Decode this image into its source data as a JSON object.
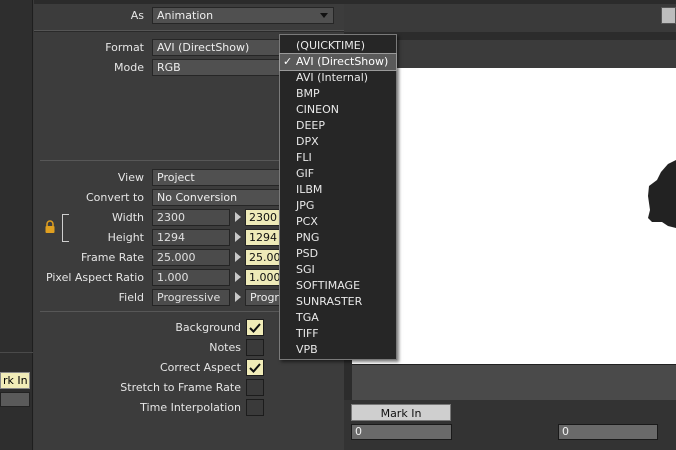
{
  "header": {
    "as_label": "As",
    "as_value": "Animation"
  },
  "settings": {
    "format_label": "Format",
    "format_value": "AVI (DirectShow)",
    "mode_label": "Mode",
    "mode_value": "RGB",
    "view_label": "View",
    "view_value": "Project",
    "convert_label": "Convert to",
    "convert_value": "No Conversion",
    "width_label": "Width",
    "width_src": "2300",
    "width_dst": "2300",
    "height_label": "Height",
    "height_src": "1294",
    "height_dst": "1294",
    "framerate_label": "Frame Rate",
    "framerate_src": "25.000",
    "framerate_dst": "25.00",
    "par_label": "Pixel Aspect Ratio",
    "par_src": "1.000",
    "par_dst": "1.000",
    "field_label": "Field",
    "field_src": "Progressive",
    "field_dst": "Progr"
  },
  "options": {
    "background_label": "Background",
    "background_checked": true,
    "notes_label": "Notes",
    "notes_checked": false,
    "correct_aspect_label": "Correct Aspect",
    "correct_aspect_checked": true,
    "stretch_label": "Stretch to Frame Rate",
    "stretch_checked": false,
    "time_interp_label": "Time Interpolation",
    "time_interp_checked": false
  },
  "format_menu": {
    "items": [
      "(QUICKTIME)",
      "AVI (DirectShow)",
      "AVI (Internal)",
      "BMP",
      "CINEON",
      "DEEP",
      "DPX",
      "FLI",
      "GIF",
      "ILBM",
      "JPG",
      "PCX",
      "PNG",
      "PSD",
      "SGI",
      "SOFTIMAGE",
      "SUNRASTER",
      "TGA",
      "TIFF",
      "VPB"
    ],
    "selected_index": 1
  },
  "viewer": {
    "mark_in_label": "Mark In",
    "mark_in_value": "0",
    "mark_out_value": "0"
  },
  "left_panel": {
    "mark_in_label": "rk In"
  },
  "colors": {
    "panel_bg": "#3c3c3c",
    "field_highlight": "#eeeab8",
    "menu_bg": "#262626",
    "menu_selected": "#5a5a5a"
  }
}
